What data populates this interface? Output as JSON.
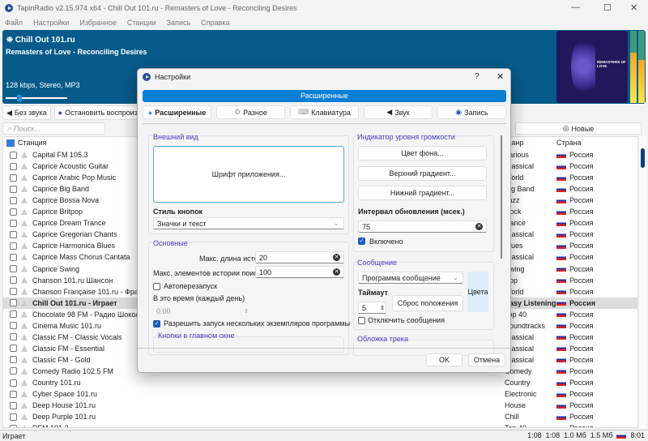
{
  "window": {
    "title": "TapinRadio v2.15.974    x64  - Chill Out 101.ru - Remasters of Love - Reconciling Desires"
  },
  "menu": [
    "Файл",
    "Настройки",
    "Избранное",
    "Станции",
    "Запись",
    "Справка"
  ],
  "player": {
    "station": "Chill Out 101.ru",
    "track": "Remasters of Love - Reconciling Desires",
    "bitrate": "128 kbps, Stereo, MP3",
    "volume": 0.22,
    "album_art_text": "REMASTERS OF LOVE",
    "vu_levels": [
      0.7,
      0.6
    ]
  },
  "toolbar": {
    "mute": "Без звука",
    "stop": "Остановить воспроизвед"
  },
  "search": {
    "placeholder": "Поиск..."
  },
  "new_button": "Новые",
  "list": {
    "col_station": "Станция",
    "col_genre": "Жанр",
    "col_country": "Страна",
    "rows": [
      {
        "name": "Capital FM 105.3",
        "genre": "Various",
        "country": "Россия"
      },
      {
        "name": "Caprice Acoustic Guitar",
        "genre": "Classical",
        "country": "Россия"
      },
      {
        "name": "Caprice Arabic Pop Music",
        "genre": "World",
        "country": "Россия"
      },
      {
        "name": "Caprice Big Band",
        "genre": "Big Band",
        "country": "Россия"
      },
      {
        "name": "Caprice Bossa Nova",
        "genre": "Jazz",
        "country": "Россия"
      },
      {
        "name": "Caprice Britpop",
        "genre": "Rock",
        "country": "Россия"
      },
      {
        "name": "Caprice Dream Trance",
        "genre": "Dance",
        "country": "Россия"
      },
      {
        "name": "Caprice Gregorian Chants",
        "genre": "Classical",
        "country": "Россия"
      },
      {
        "name": "Caprice Harmonica Blues",
        "genre": "Blues",
        "country": "Россия"
      },
      {
        "name": "Caprice Mass Chorus Cantata",
        "genre": "Classical",
        "country": "Россия"
      },
      {
        "name": "Caprice Swing",
        "genre": "Swing",
        "country": "Россия"
      },
      {
        "name": "Chanson 101.ru Шансон",
        "genre": "Pop",
        "country": "Россия"
      },
      {
        "name": "Chanson Française 101.ru - Францу",
        "genre": "World",
        "country": "Россия"
      },
      {
        "name": "Chill Out 101.ru - Играет",
        "genre": "Easy Listening",
        "country": "Россия",
        "selected": true
      },
      {
        "name": "Chocolate 98 FM - Радио Шоколад",
        "genre": "Top 40",
        "country": "Россия"
      },
      {
        "name": "Cinema Music 101.ru",
        "genre": "Soundtracks",
        "country": "Россия"
      },
      {
        "name": "Classic FM - Classic Vocals",
        "genre": "Classical",
        "country": "Россия"
      },
      {
        "name": "Classic FM - Essential",
        "genre": "Classical",
        "country": "Россия"
      },
      {
        "name": "Classic FM - Gold",
        "genre": "Classical",
        "country": "Россия"
      },
      {
        "name": "Comedy Radio 102.5 FM",
        "genre": "Comedy",
        "country": "Россия"
      },
      {
        "name": "Country 101.ru",
        "genre": "Country",
        "country": "Россия"
      },
      {
        "name": "Cyber Space 101.ru",
        "genre": "Electronic",
        "country": "Россия"
      },
      {
        "name": "Deep House 101.ru",
        "genre": "House",
        "country": "Россия"
      },
      {
        "name": "Deep Purple 101.ru",
        "genre": "Chill",
        "country": "Россия"
      },
      {
        "name": "DFM 101.2",
        "genre": "Top 40",
        "country": "Россия"
      }
    ]
  },
  "status": {
    "left": "Играет",
    "t1": "1:08",
    "t2": "1:08",
    "s1": "1.0 Мб",
    "s2": "1.5 Мб",
    "clock": "8:01"
  },
  "dialog": {
    "title": "Настройки",
    "help": "?",
    "banner": "Расширенные",
    "tabs": [
      "Расширенные",
      "Разное",
      "Клавиатура",
      "Звук",
      "Запись"
    ],
    "appearance": {
      "title": "Внешний вид",
      "font_button": "Шрифт приложения...",
      "button_style_label": "Стиль кнопок",
      "button_style_value": "Значки и текст"
    },
    "basic": {
      "title": "Основные",
      "history_len_label": "Макс. длина истории",
      "history_len": "20",
      "search_hist_label": "Макс. элементов истории поиска",
      "search_hist": "100",
      "autorestart": "Автоперезапуск",
      "autorestart_checked": false,
      "time_label": "В это время (каждый день)",
      "time_value": "0:00",
      "multi": "Разрешить запуск нескольких экземпляров программы",
      "multi_checked": true,
      "buttons_group": "Кнопки в главном окне"
    },
    "vu": {
      "title": "Индикатор уровня громкости",
      "bg": "Цвет фона...",
      "top": "Верхний градиент...",
      "bottom": "Нижний градиент...",
      "interval_label": "Интервал обновления (мсек.)",
      "interval": "75",
      "enabled": "Включено",
      "enabled_checked": true
    },
    "message": {
      "title": "Сообщение",
      "program": "Программа сообщение",
      "timeout_label": "Таймаут",
      "timeout": "5",
      "reset": "Сброс положения",
      "colors": "Цвета",
      "disable": "Отключить сообщения",
      "disable_checked": false
    },
    "cover": {
      "title": "Обложка трека"
    },
    "ok": "OK",
    "cancel": "Отмена"
  },
  "colors": {
    "player_bg": "#075b8a",
    "accent": "#0a7fd4",
    "group_title": "#4a3cc4"
  }
}
